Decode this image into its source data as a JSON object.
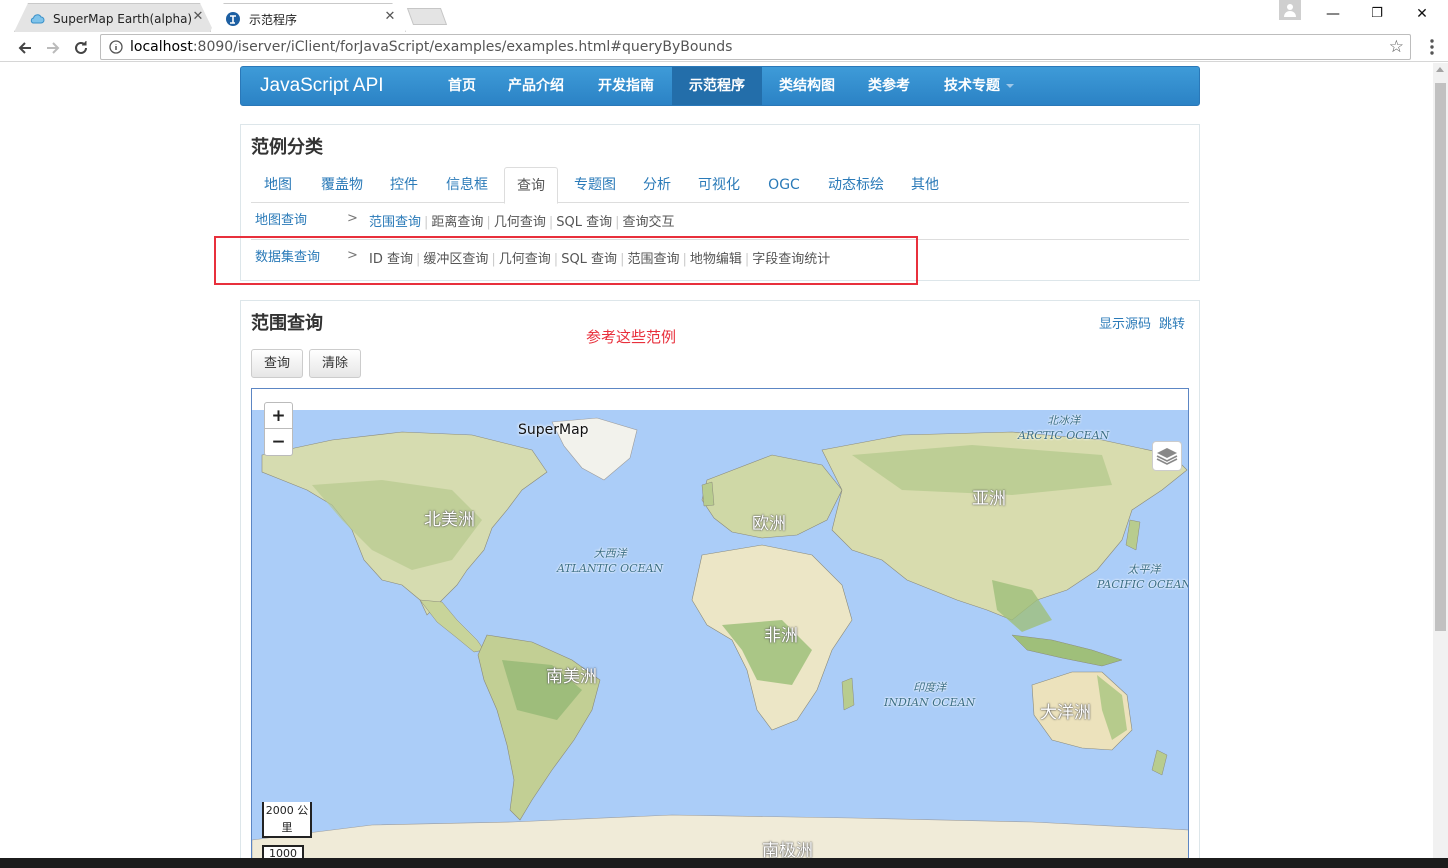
{
  "browser": {
    "tabs": [
      {
        "title": "SuperMap Earth(alpha)",
        "active": false
      },
      {
        "title": "示范程序",
        "active": true
      }
    ],
    "url_host": "localhost",
    "url_path": ":8090/iserver/iClient/forJavaScript/examples/examples.html#queryByBounds",
    "window_controls": {
      "minimize": "—",
      "restore": "❐",
      "close": "✕"
    }
  },
  "navbar": {
    "brand": "JavaScript API",
    "items": [
      "首页",
      "产品介绍",
      "开发指南",
      "示范程序",
      "类结构图",
      "类参考",
      "技术专题"
    ],
    "active_item": "示范程序"
  },
  "categories": {
    "title": "范例分类",
    "tabs": [
      "地图",
      "覆盖物",
      "控件",
      "信息框",
      "查询",
      "专题图",
      "分析",
      "可视化",
      "OGC",
      "动态标绘",
      "其他"
    ],
    "active_tab": "查询",
    "rows": [
      {
        "label": "地图查询",
        "gt": ">",
        "links": [
          "范围查询",
          "距离查询",
          "几何查询",
          "SQL 查询",
          "查询交互"
        ]
      },
      {
        "label": "数据集查询",
        "gt": ">",
        "links": [
          "ID 查询",
          "缓冲区查询",
          "几何查询",
          "SQL 查询",
          "范围查询",
          "地物编辑",
          "字段查询统计"
        ]
      }
    ]
  },
  "demo": {
    "title": "范围查询",
    "show_source": "显示源码",
    "jump": "跳转",
    "annotation": "参考这些范例",
    "query_button": "查询",
    "clear_button": "清除",
    "map": {
      "logo": "SuperMap",
      "zoom_in": "+",
      "zoom_out": "−",
      "continents": {
        "north_america": "北美洲",
        "europe": "欧洲",
        "asia": "亚洲",
        "africa": "非洲",
        "south_america": "南美洲",
        "oceania": "大洋洲",
        "antarctica": "南极洲"
      },
      "oceans": {
        "arctic_cn": "北冰洋",
        "arctic_en": "ARCTIC OCEAN",
        "atlantic_cn": "大西洋",
        "atlantic_en": "ATLANTIC OCEAN",
        "pacific_cn": "太平洋",
        "pacific_en": "PACIFIC OCEAN",
        "indian_cn": "印度洋",
        "indian_en": "INDIAN OCEAN"
      },
      "scale_top": "2000 公里",
      "scale_bottom": "1000"
    }
  },
  "colors": {
    "nav_blue": "#2b82c5",
    "link_blue": "#2a7ab8",
    "annotation_red": "#e8303c",
    "ocean": "#abcdf8",
    "land": "#ece6c6"
  }
}
